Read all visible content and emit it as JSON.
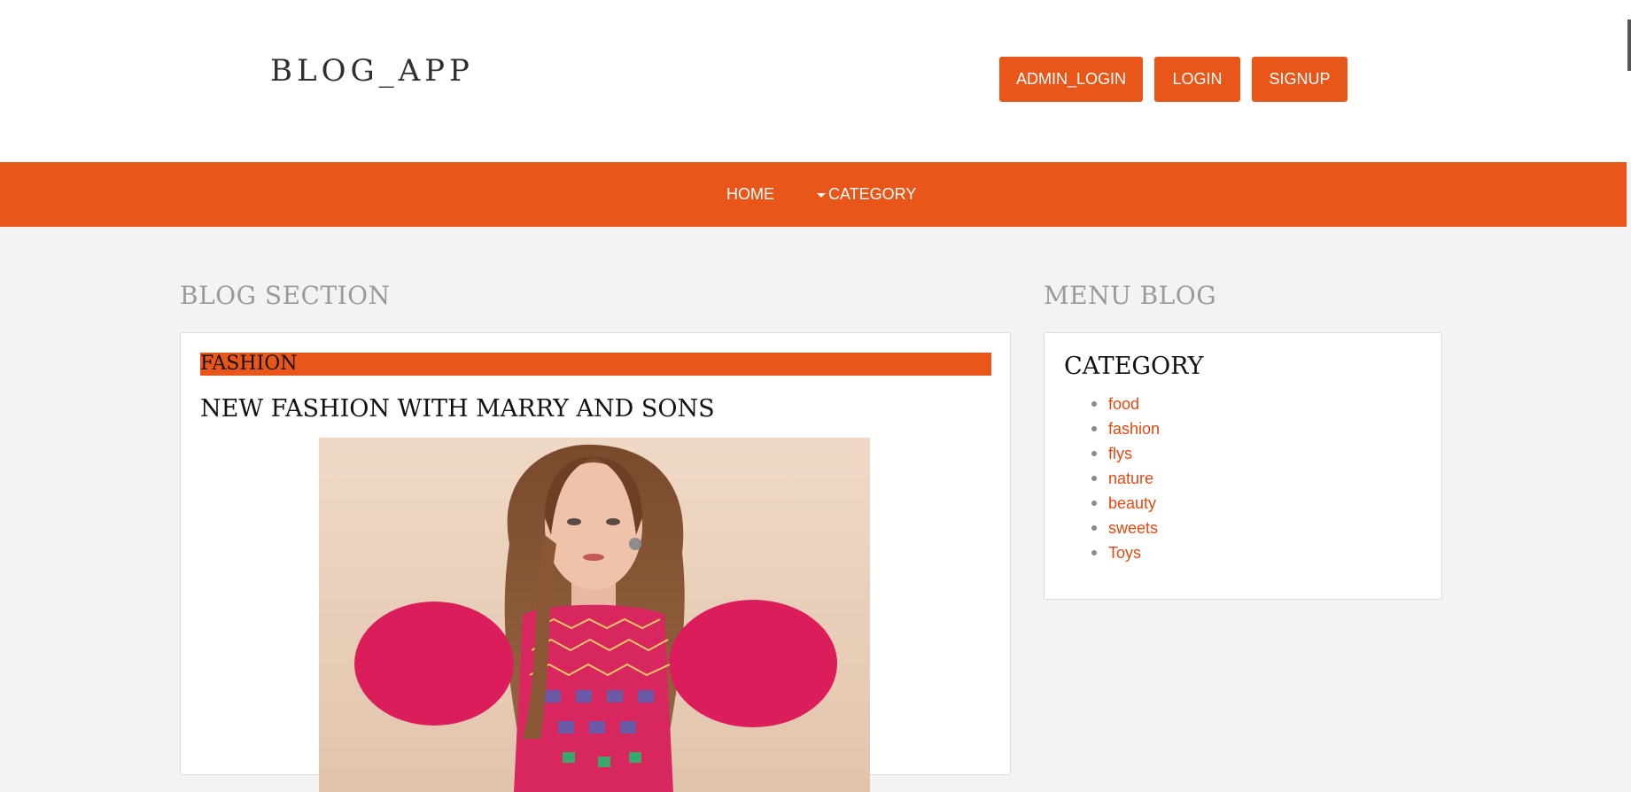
{
  "header": {
    "brand": "BLOG_APP",
    "buttons": {
      "admin_login": "ADMIN_LOGIN",
      "login": "LOGIN",
      "signup": "SIGNUP"
    }
  },
  "nav": {
    "home": "HOME",
    "category": "CATEGORY"
  },
  "blog_section": {
    "heading": "BLOG SECTION",
    "post": {
      "category": "FASHION",
      "title": "NEW FASHION WITH MARRY AND SONS"
    }
  },
  "menu_blog": {
    "heading": "MENU BLOG",
    "title": "CATEGORY",
    "categories": [
      "food",
      "fashion",
      "flys",
      "nature",
      "beauty",
      "sweets",
      "Toys"
    ]
  },
  "colors": {
    "accent": "#e9561a",
    "link": "#e24a12",
    "background": "#f3f3f3",
    "muted_heading": "#9a9a9a"
  }
}
